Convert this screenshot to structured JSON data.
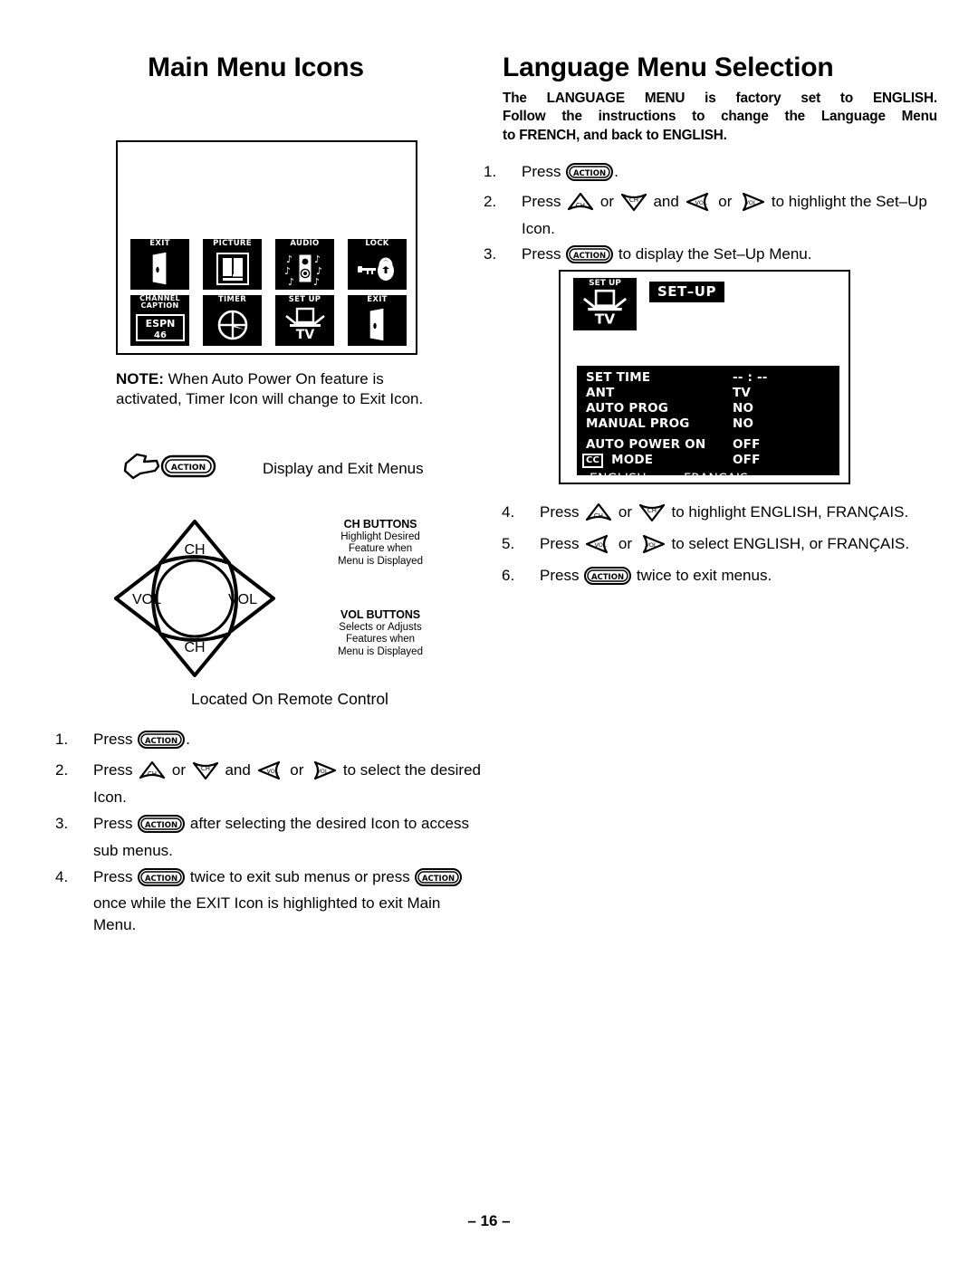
{
  "page": {
    "number_label": "– 16 –"
  },
  "left_column": {
    "title": "Main Menu Icons",
    "tv_screen": {
      "icons": [
        {
          "caption": "EXIT",
          "icon": "door-icon"
        },
        {
          "caption": "PICTURE",
          "icon": "picture-icon"
        },
        {
          "caption": "AUDIO",
          "icon": "speaker-notes-icon"
        },
        {
          "caption": "LOCK",
          "icon": "key-padlock-icon"
        },
        {
          "caption": "CHANNEL CAPTION",
          "caption_line1": "CHANNEL",
          "caption_line2": "CAPTION",
          "icon": "channel-caption-icon",
          "sample_channel_name": "ESPN",
          "sample_channel_number": "46"
        },
        {
          "caption": "TIMER",
          "icon": "clock-icon"
        },
        {
          "caption": "SET UP",
          "icon": "tv-stand-icon",
          "tv_label": "TV"
        },
        {
          "caption": "EXIT",
          "icon": "door-icon"
        }
      ]
    },
    "note": {
      "label": "NOTE:",
      "text": " When Auto Power On feature is activated, Timer Icon will change to Exit Icon."
    },
    "action_hand_label": "Display and Exit Menus",
    "remote": {
      "dpad": {
        "up_label": "CH",
        "down_label": "CH",
        "left_label": "VOL",
        "right_label": "VOL"
      },
      "ch_buttons": {
        "heading": "CH BUTTONS",
        "line1": "Highlight Desired",
        "line2": "Feature when",
        "line3": "Menu is Displayed"
      },
      "vol_buttons": {
        "heading": "VOL BUTTONS",
        "line1": "Selects or Adjusts",
        "line2": "Features when",
        "line3": "Menu is Displayed"
      },
      "located_label": "Located On Remote Control"
    },
    "steps": [
      {
        "num": "1.",
        "parts": [
          "Press ",
          "ACTION_KEY",
          "."
        ]
      },
      {
        "num": "2.",
        "parts": [
          "Press ",
          "CH_UP_KEY",
          " or ",
          "CH_DOWN_KEY",
          " and ",
          "VOL_LEFT_KEY",
          " or ",
          "VOL_RIGHT_KEY",
          " to select the desired Icon."
        ]
      },
      {
        "num": "3.",
        "parts": [
          "Press ",
          "ACTION_KEY",
          " after selecting the desired Icon to access sub menus."
        ]
      },
      {
        "num": "4.",
        "parts": [
          "Press ",
          "ACTION_KEY",
          " twice to exit sub menus or press ",
          "ACTION_KEY",
          " once while the EXIT Icon is highlighted to exit Main Menu."
        ]
      }
    ],
    "step_text": {
      "s1_a": "Press ",
      "s1_b": ".",
      "s2_a": "Press ",
      "s2_b": " or ",
      "s2_c": " and ",
      "s2_d": " or ",
      "s2_e": " to select the desired Icon.",
      "s3_a": "Press ",
      "s3_b": " after selecting the desired Icon to access sub menus.",
      "s4_a": "Press ",
      "s4_b": " twice to exit sub menus or press ",
      "s4_c": " once while the EXIT Icon is highlighted to exit Main Menu."
    },
    "step_nums": [
      "1.",
      "2.",
      "3.",
      "4."
    ]
  },
  "right_column": {
    "title": "Language Menu Selection",
    "intro": {
      "line1": "The LANGUAGE MENU is factory set to ENGLISH.",
      "line2": "Follow the instructions to change the Language Menu",
      "line3": "to FRENCH, and back to ENGLISH."
    },
    "steps_top": {
      "nums": [
        "1.",
        "2.",
        "3."
      ],
      "s1_a": "Press ",
      "s1_b": ".",
      "s2_a": "Press ",
      "s2_b": " or ",
      "s2_c": " and ",
      "s2_d": " or ",
      "s2_e": " to highlight the Set–Up Icon.",
      "s3_a": "Press ",
      "s3_b": " to display the Set–Up Menu."
    },
    "setup_screen": {
      "icon_caption": "SET UP",
      "icon_tv_label": "TV",
      "title_banner": "SET–UP",
      "rows": [
        {
          "label": "SET TIME",
          "value": "-- : --"
        },
        {
          "label": "ANT",
          "value": "TV"
        },
        {
          "label": "AUTO PROG",
          "value": "NO"
        },
        {
          "label": "MANUAL PROG",
          "value": "NO"
        },
        {
          "label": "AUTO POWER ON",
          "value": "OFF"
        },
        {
          "label": "MODE",
          "value": "OFF",
          "badge": "CC"
        }
      ],
      "languages": {
        "english": "ENGLISH",
        "french": "FRANCAIS"
      }
    },
    "steps_bottom": {
      "nums": [
        "4.",
        "5.",
        "6."
      ],
      "s4_a": "Press ",
      "s4_b": " or ",
      "s4_c": " to highlight ENGLISH, FRANÇAIS.",
      "s5_a": "Press ",
      "s5_b": " or ",
      "s5_c": " to select ENGLISH, or FRANÇAIS.",
      "s6_a": "Press ",
      "s6_b": " twice to exit menus."
    }
  },
  "glyphs": {
    "action_key_label": "ACTION",
    "ch_label": "CH",
    "vol_label": "VOL"
  }
}
